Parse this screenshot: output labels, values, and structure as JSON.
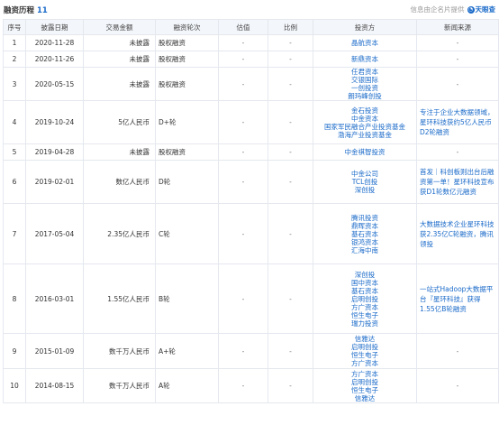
{
  "header": {
    "title": "融资历程",
    "count": "11",
    "source_text": "信息由企名片提供",
    "brand": "天眼查"
  },
  "columns": [
    "序号",
    "披露日期",
    "交易金额",
    "融资轮次",
    "估值",
    "比例",
    "投资方",
    "新闻来源"
  ],
  "rows": [
    {
      "no": "1",
      "date": "2020-11-28",
      "amount": "未披露",
      "round": "股权融资",
      "valuation": "-",
      "ratio": "-",
      "investors": [
        "晶航资本"
      ],
      "news": "-"
    },
    {
      "no": "2",
      "date": "2020-11-26",
      "amount": "未披露",
      "round": "股权融资",
      "valuation": "-",
      "ratio": "-",
      "investors": [
        "新鼎资本"
      ],
      "news": "-"
    },
    {
      "no": "3",
      "date": "2020-05-15",
      "amount": "未披露",
      "round": "股权融资",
      "valuation": "-",
      "ratio": "-",
      "investors": [
        "任君资本",
        "交银国际",
        "一创投资",
        "朗玛峰创投"
      ],
      "news": "-"
    },
    {
      "no": "4",
      "date": "2019-10-24",
      "amount": "5亿人民币",
      "round": "D+轮",
      "valuation": "-",
      "ratio": "-",
      "investors": [
        "金石投资",
        "中金资本",
        "国家军民融合产业投资基金",
        "渤海产业投资基金"
      ],
      "news": "专注于企业大数据领域，星环科技获约5亿人民币D2轮融资"
    },
    {
      "no": "5",
      "date": "2019-04-28",
      "amount": "未披露",
      "round": "股权融资",
      "valuation": "-",
      "ratio": "-",
      "investors": [
        "中金祺智投资"
      ],
      "news": "-"
    },
    {
      "no": "6",
      "date": "2019-02-01",
      "amount": "数亿人民币",
      "round": "D轮",
      "valuation": "-",
      "ratio": "-",
      "investors": [
        "中金公司",
        "TCL创投",
        "深创投"
      ],
      "news": "首发｜科创板则出台后融资第一单！星环科技宣布获D1轮数亿元融资"
    },
    {
      "no": "7",
      "date": "2017-05-04",
      "amount": "2.35亿人民币",
      "round": "C轮",
      "valuation": "-",
      "ratio": "-",
      "investors": [
        "腾讯投资",
        "鼎晖资本",
        "基石资本",
        "银鸿资本",
        "汇海中南"
      ],
      "news": "大数据技术企业星环科技获2.35亿C轮融资，腾讯领投"
    },
    {
      "no": "8",
      "date": "2016-03-01",
      "amount": "1.55亿人民币",
      "round": "B轮",
      "valuation": "-",
      "ratio": "-",
      "investors": [
        "深创投",
        "国中资本",
        "基石资本",
        "启明创投",
        "方广资本",
        "恒生电子",
        "瑞力投资"
      ],
      "news": "一站式Hadoop大数据平台『星环科技』获得1.55亿B轮融资"
    },
    {
      "no": "9",
      "date": "2015-01-09",
      "amount": "数千万人民币",
      "round": "A+轮",
      "valuation": "-",
      "ratio": "-",
      "investors": [
        "信雅达",
        "启明创投",
        "恒生电子",
        "方广资本"
      ],
      "news": "-"
    },
    {
      "no": "10",
      "date": "2014-08-15",
      "amount": "数千万人民币",
      "round": "A轮",
      "valuation": "-",
      "ratio": "-",
      "investors": [
        "方广资本",
        "启明创投",
        "恒生电子",
        "信雅达"
      ],
      "news": "-"
    }
  ]
}
